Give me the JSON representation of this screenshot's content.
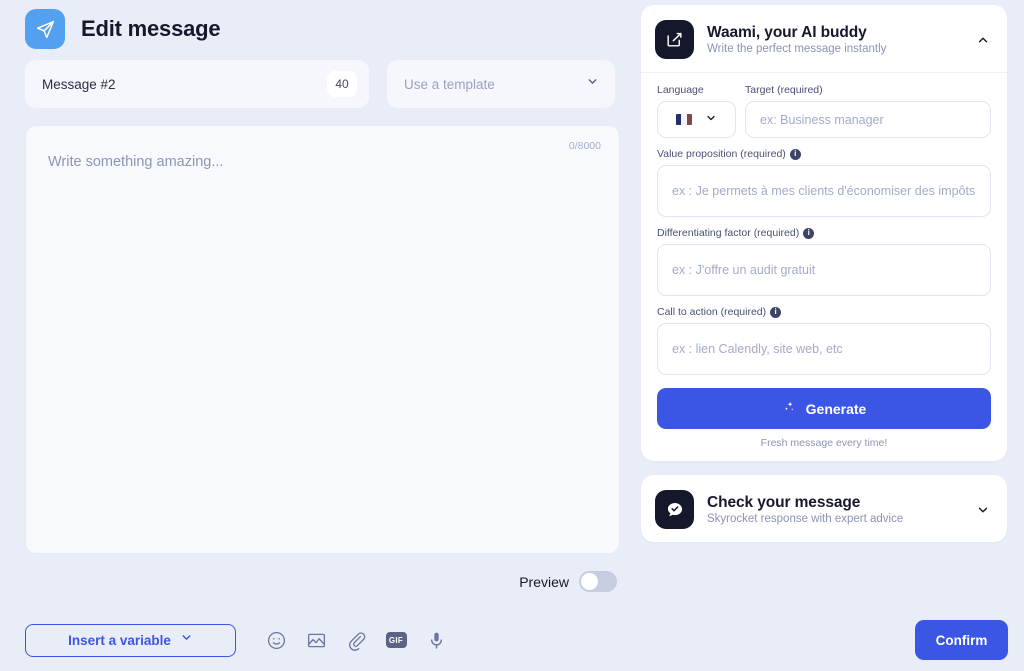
{
  "header": {
    "title": "Edit message",
    "icon": "send-plane-icon"
  },
  "message_tab": {
    "label": "Message #2",
    "count": "40"
  },
  "template_select": {
    "placeholder": "Use a template",
    "icon": "chevron-down-icon"
  },
  "editor": {
    "placeholder": "Write something amazing...",
    "counter": "0/8000"
  },
  "preview": {
    "label": "Preview",
    "enabled": false
  },
  "bottom_toolbar": {
    "insert_variable_label": "Insert a variable",
    "icons": [
      {
        "name": "emoji-icon",
        "label": "Emoji"
      },
      {
        "name": "image-icon",
        "label": "Image"
      },
      {
        "name": "attachment-icon",
        "label": "Attachment"
      },
      {
        "name": "gif-icon",
        "label": "GIF"
      },
      {
        "name": "microphone-icon",
        "label": "Voice"
      }
    ],
    "confirm_label": "Confirm"
  },
  "ai_card": {
    "icon": "edit-square-icon",
    "title": "Waami, your AI buddy",
    "subtitle": "Write the perfect message instantly",
    "expanded": true,
    "chevron": "chevron-up-icon",
    "language": {
      "label": "Language",
      "value": "fr",
      "flag": "flag-france-icon"
    },
    "target": {
      "label": "Target (required)",
      "placeholder": "ex: Business manager",
      "value": ""
    },
    "value_proposition": {
      "label": "Value proposition (required)",
      "placeholder": "ex : Je permets à mes clients d'économiser des impôts",
      "value": "",
      "info": "i"
    },
    "differentiating_factor": {
      "label": "Differentiating factor (required)",
      "placeholder": "ex : J'offre un audit gratuit",
      "value": "",
      "info": "i"
    },
    "call_to_action": {
      "label": "Call to action (required)",
      "placeholder": "ex : lien Calendly, site web, etc",
      "value": "",
      "info": "i"
    },
    "generate_label": "Generate",
    "generate_icon": "sparkle-icon",
    "generate_note": "Fresh message every time!"
  },
  "check_card": {
    "icon": "chat-check-icon",
    "title": "Check your message",
    "subtitle": "Skyrocket response with expert advice",
    "expanded": false,
    "chevron": "chevron-down-icon"
  },
  "colors": {
    "background": "#e9edf8",
    "primary": "#3b56e5",
    "header_icon": "#54a0f0",
    "card_badge": "#15182b",
    "text_dark": "#16192c",
    "text_muted": "#8b93b2"
  }
}
